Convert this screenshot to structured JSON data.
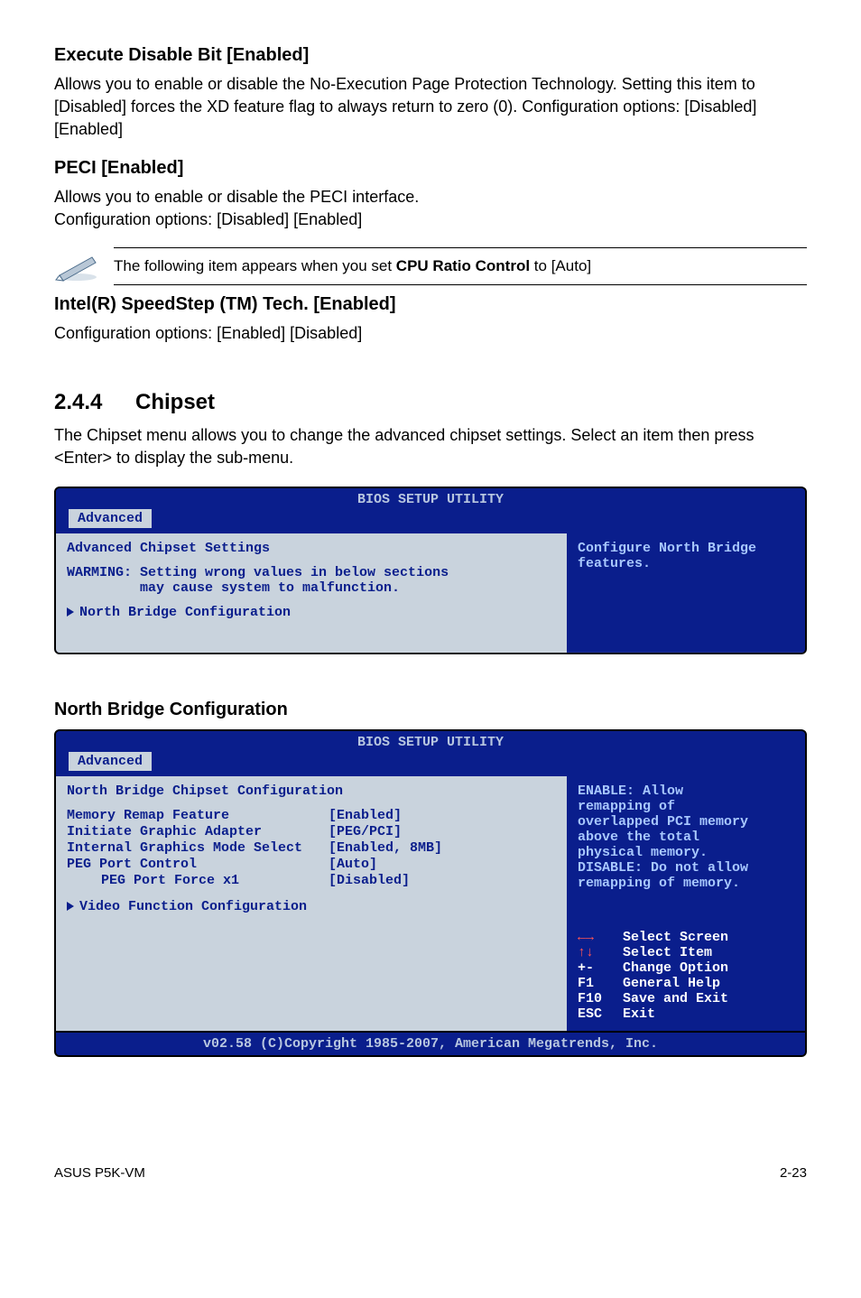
{
  "sec1": {
    "title": "Execute Disable Bit [Enabled]",
    "body": "Allows you to enable or disable the No-Execution Page Protection Technology. Setting this item to [Disabled] forces the XD feature flag to always return to zero (0). Configuration options: [Disabled] [Enabled]"
  },
  "sec2": {
    "title": "PECI [Enabled]",
    "body1": "Allows you to enable or disable the PECI interface.",
    "body2": "Configuration options: [Disabled] [Enabled]"
  },
  "note": {
    "prefix": "The following item appears when you set ",
    "bold": "CPU Ratio Control",
    "suffix": " to [Auto]"
  },
  "sec3": {
    "title": "Intel(R) SpeedStep (TM) Tech. [Enabled]",
    "body": "Configuration options: [Enabled] [Disabled]"
  },
  "chipset": {
    "num": "2.4.4",
    "title": "Chipset",
    "body": "The Chipset menu allows you to change the advanced chipset settings. Select an item then press <Enter> to display the sub-menu."
  },
  "bios1": {
    "title": "BIOS SETUP UTILITY",
    "tab": "Advanced",
    "heading": "Advanced Chipset Settings",
    "warn1": "WARMING: Setting wrong values in below sections",
    "warn2": "         may cause system to malfunction.",
    "link": "North Bridge Configuration",
    "help1": "Configure North Bridge",
    "help2": "features."
  },
  "nb_heading": "North Bridge Configuration",
  "bios2": {
    "title": "BIOS SETUP UTILITY",
    "tab": "Advanced",
    "heading": "North Bridge Chipset Configuration",
    "rows": [
      {
        "label": "Memory Remap Feature",
        "val": "[Enabled]"
      },
      {
        "label": "Initiate Graphic Adapter",
        "val": "[PEG/PCI]"
      },
      {
        "label": "Internal Graphics Mode Select",
        "val": "[Enabled, 8MB]"
      },
      {
        "label": "PEG Port Control",
        "val": "[Auto]"
      },
      {
        "label": "  PEG Port Force x1",
        "val": "[Disabled]",
        "indent": true
      }
    ],
    "link": "Video Function Configuration",
    "help": [
      "ENABLE: Allow",
      "remapping of",
      "overlapped PCI memory",
      "above the total",
      "physical memory.",
      "",
      "DISABLE: Do not allow",
      "remapping of memory."
    ],
    "keys": [
      {
        "k": "←→",
        "t": "Select Screen",
        "arrow": true
      },
      {
        "k": "↑↓",
        "t": "Select Item",
        "arrow": true
      },
      {
        "k": "+-",
        "t": "Change Option"
      },
      {
        "k": "F1",
        "t": "General Help"
      },
      {
        "k": "F10",
        "t": "Save and Exit"
      },
      {
        "k": "ESC",
        "t": "Exit"
      }
    ],
    "footer": "v02.58 (C)Copyright 1985-2007, American Megatrends, Inc."
  },
  "footer": {
    "left": "ASUS P5K-VM",
    "right": "2-23"
  }
}
